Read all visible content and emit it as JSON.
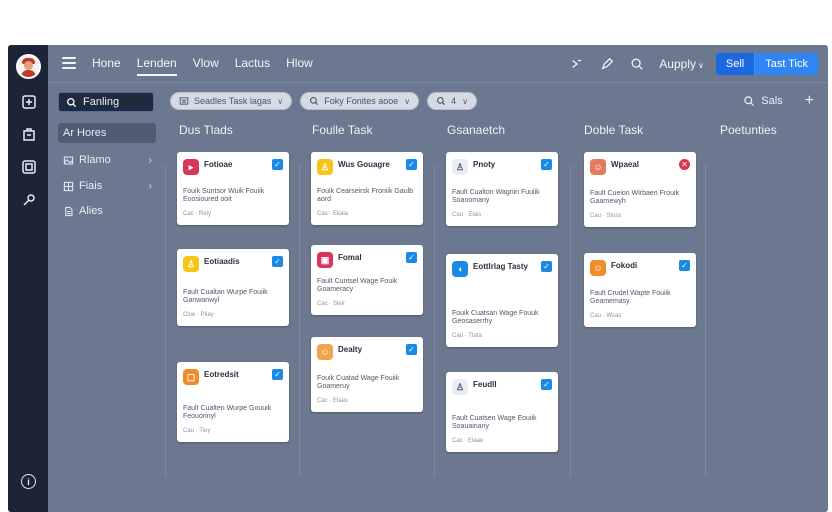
{
  "topbar": {
    "nav": [
      {
        "label": "Hone",
        "active": false
      },
      {
        "label": "Lenden",
        "active": true
      },
      {
        "label": "Vlow",
        "active": false
      },
      {
        "label": "Lactus",
        "active": false
      },
      {
        "label": "Hlow",
        "active": false
      }
    ],
    "apply_label": "Aupply",
    "sell_label": "Sell",
    "new_task_label": "Tast Tick"
  },
  "sidebar": {
    "search_label": "Fanling",
    "items": [
      {
        "label": "Ar Hores",
        "icon": "none"
      },
      {
        "label": "Rlamo",
        "icon": "image-icon",
        "caret": "›"
      },
      {
        "label": "Fiais",
        "icon": "grid-icon",
        "caret": "›"
      },
      {
        "label": "Alies",
        "icon": "doc-icon"
      }
    ]
  },
  "filters": [
    {
      "label": "Seadles Task lagas",
      "icon": "list-icon"
    },
    {
      "label": "Foky Fonites aooe",
      "icon": "search-icon"
    },
    {
      "label": "4",
      "icon": "search-icon"
    }
  ],
  "right_tools": {
    "search_label": "Sals",
    "plus": "+"
  },
  "columns": [
    {
      "title": "Dus Tlads",
      "cards": [
        {
          "title": "Fotioae",
          "icon_color": "#d9345a",
          "icon_glyph": "▸",
          "desc": "Fouik Suntsor Wuik Fouiik Eoosioured ooit",
          "meta": "Cac · Reiy",
          "check": "✓",
          "check_color": "#1a8ae6"
        },
        {
          "title": "Eotiaadis",
          "icon_color": "#f5c518",
          "icon_glyph": "♙",
          "desc": "Fault Cualtan Wurpe Fouiik Ganwanwyl",
          "meta": "Clue · Pliay",
          "check": "✓",
          "check_color": "#1a8ae6"
        },
        {
          "title": "Eotredsit",
          "icon_color": "#f28c28",
          "icon_glyph": "▢",
          "desc": "Fault Cualten Wurpe Gouuik Feouorinyl",
          "meta": "Cau · Tiey",
          "check": "✓",
          "check_color": "#1a8ae6"
        }
      ]
    },
    {
      "title": "Foulle Task",
      "cards": [
        {
          "title": "Wus Gouagre",
          "icon_color": "#f5c518",
          "icon_glyph": "♙",
          "desc": "Fouik Cearseirsk Froniik Gaulb aord",
          "meta": "Cas · Ekaia",
          "check": "✓",
          "check_color": "#1a8ae6"
        },
        {
          "title": "Fomal",
          "icon_color": "#d9345a",
          "icon_glyph": "▣",
          "desc": "Fault Cuntsel Wage Fouik Goameracy",
          "meta": "Cac · Sleir",
          "check": "✓",
          "check_color": "#1a8ae6"
        },
        {
          "title": "Dealty",
          "icon_color": "#f0a44c",
          "icon_glyph": "☺",
          "desc": "Fouik Cuatad Wage Fouiik Goameruy",
          "meta": "Cac · Elaas",
          "check": "✓",
          "check_color": "#1a8ae6"
        }
      ]
    },
    {
      "title": "Gsanaetch",
      "cards": [
        {
          "title": "Pnoty",
          "icon_color": "#e8edf4",
          "icon_glyph": "♙",
          "desc": "Fault Cualton Wagnin Fuulik Soanomany",
          "meta": "Cou · Elais",
          "check": "✓",
          "check_color": "#1a8ae6"
        },
        {
          "title": "Eottlrlag Tasty",
          "icon_color": "#1a8ae6",
          "icon_glyph": "◖",
          "desc": "Fouik Cuatsan Wage Fouuk Geosaserrhy",
          "meta": "Cau · Ttata",
          "check": "✓",
          "check_color": "#1a8ae6"
        },
        {
          "title": "Feudll",
          "icon_color": "#e8edf4",
          "icon_glyph": "♙",
          "desc": "Fault Cuatsen Wage Eouiik Soauainany",
          "meta": "Cac · Elaae",
          "check": "✓",
          "check_color": "#1a8ae6"
        }
      ]
    },
    {
      "title": "Doble Task",
      "cards": [
        {
          "title": "Wpaeal",
          "icon_color": "#e57a60",
          "icon_glyph": "☺",
          "desc": "Fault Cueion Wirbaen Frouik Gaarnewyh",
          "meta": "Cau · Stoss",
          "check": "✕",
          "check_color": "#e0344c"
        },
        {
          "title": "Fokodi",
          "icon_color": "#f28c28",
          "icon_glyph": "☺",
          "desc": "Fault Crudel Wapte Fouiik Geamemasy",
          "meta": "Cau · Wsas",
          "check": "✓",
          "check_color": "#1a8ae6"
        }
      ]
    },
    {
      "title": "Poetunties",
      "cards": []
    }
  ]
}
